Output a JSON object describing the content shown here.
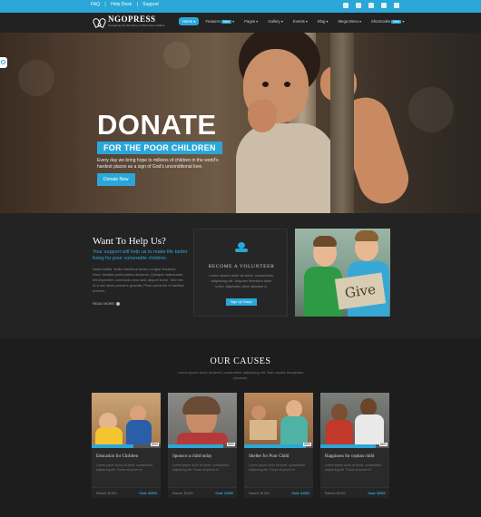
{
  "topbar": {
    "links": [
      "FAQ",
      "Help Desk",
      "Support"
    ],
    "social_icons": [
      "facebook-icon",
      "twitter-icon",
      "pinterest-icon",
      "google-plus-icon",
      "linkedin-icon"
    ]
  },
  "header": {
    "logo_title": "NGOPRESS",
    "logo_tagline": "Navigating the Shoreline of NGOs Exemplifiers",
    "nav": [
      {
        "label": "Home",
        "badge": ""
      },
      {
        "label": "Features",
        "badge": "New"
      },
      {
        "label": "Pages",
        "badge": ""
      },
      {
        "label": "Gallery",
        "badge": ""
      },
      {
        "label": "Events",
        "badge": ""
      },
      {
        "label": "Blog",
        "badge": ""
      },
      {
        "label": "Mega Menu",
        "badge": ""
      },
      {
        "label": "Shortcodes",
        "badge": "New"
      }
    ]
  },
  "hero": {
    "title": "DONATE",
    "subtitle": "FOR THE POOR CHILDREN",
    "text": "Every day we bring hope to millions of children in the world's hardest places as a sign of God's unconditional love.",
    "button": "Donate Now"
  },
  "help": {
    "title": "Want To Help Us?",
    "highlight": "Your support will help us to make life better living for poor vulnerable children.",
    "body": "Nulla facilisi. Nulla maximus lectus congue tincidunt. Nunc facilisis porta platea dictumst. Quisque malesuada elit imperdiet, commodo eros sed, aliquet tortor. Sed nec ut a nisi lacus posuere gravida. Proin porta leo et facilisis pretium.",
    "read_more": "READ MORE",
    "volunteer": {
      "title": "BECOME A VOLUNTEER",
      "text": "Lorem ipsum dolor sit amet, consectetur adipiscing elit. Aliquam interdum diam tortor, dignissim diam aliquam a.",
      "button": "Sign Up Today!"
    },
    "photo_sign": "Give"
  },
  "causes": {
    "title": "OUR CAUSES",
    "subtitle": "Lorem ipsum dolor sit amet, consectetur adipiscing elit. Nam auctor tempestas placerat.",
    "items": [
      {
        "name": "Education for Children",
        "text": "Lorem ipsum dolor sit amet, consectetur adipiscing elit. Fusce at ipsum et.",
        "percent": "60%",
        "progress": 60,
        "raised": "Raised: $1000",
        "goal": "Goal: $2500"
      },
      {
        "name": "Sponsor a child today",
        "text": "Lorem ipsum dolor sit amet, consectetur adipiscing elit. Fusce at ipsum et.",
        "percent": "80%",
        "progress": 80,
        "raised": "Raised: $1000",
        "goal": "Goal: $1500"
      },
      {
        "name": "Shelter for Poor Child",
        "text": "Lorem ipsum dolor sit amet, consectetur adipiscing elit. Fusce at ipsum et.",
        "percent": "90%",
        "progress": 90,
        "raised": "Raised: $1000",
        "goal": "Goal: $1500"
      },
      {
        "name": "Happiness for orphan child",
        "text": "Lorem ipsum dolor sit amet, consectetur adipiscing elit. Fusce at ipsum et.",
        "percent": "80%",
        "progress": 80,
        "raised": "Raised: $1000",
        "goal": "Goal: $2500"
      }
    ]
  },
  "colors": {
    "accent": "#2aa7d8",
    "dark": "#1f1f1f"
  }
}
